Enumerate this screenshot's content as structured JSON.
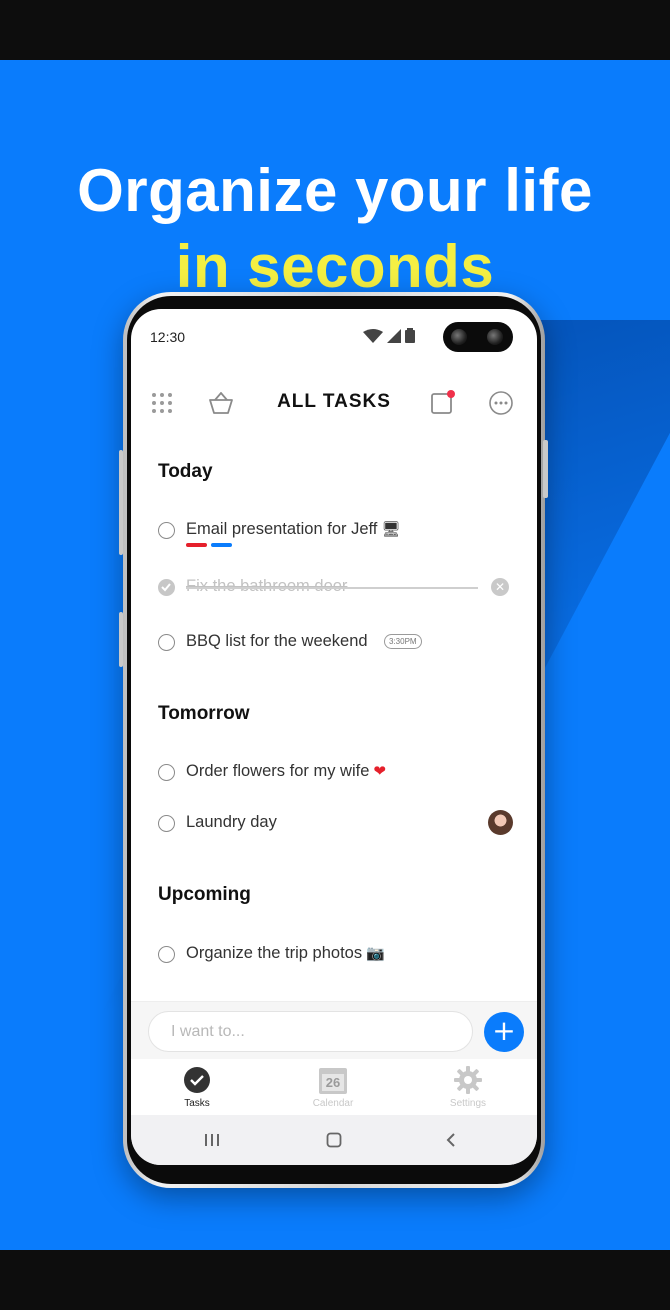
{
  "headline": {
    "line1": "Organize your life",
    "line2": "in seconds"
  },
  "status_bar": {
    "time": "12:30"
  },
  "header": {
    "title": "ALL TASKS"
  },
  "sections": [
    {
      "title": "Today",
      "tasks": [
        {
          "text": "Email presentation for Jeff",
          "emoji": "🖥",
          "done": false,
          "tags": [
            "#e5202b",
            "#0a7cfc"
          ]
        },
        {
          "text": "Fix the bathroom door",
          "done": true
        },
        {
          "text": "BBQ list for the weekend",
          "time": "3:30PM",
          "done": false
        }
      ]
    },
    {
      "title": "Tomorrow",
      "tasks": [
        {
          "text": "Order flowers for my wife",
          "emoji": "❤",
          "done": false
        },
        {
          "text": "Laundry day",
          "has_avatar": true,
          "done": false
        }
      ]
    },
    {
      "title": "Upcoming",
      "tasks": [
        {
          "text": "Organize the trip photos",
          "emoji": "📷",
          "done": false
        }
      ]
    }
  ],
  "input": {
    "placeholder": "I want to..."
  },
  "tabs": [
    {
      "label": "Tasks",
      "icon": "check-circle-icon",
      "active": true
    },
    {
      "label": "Calendar",
      "icon": "calendar-icon",
      "day": "26",
      "active": false
    },
    {
      "label": "Settings",
      "icon": "gear-icon",
      "active": false
    }
  ],
  "colors": {
    "background": "#0a7cfc",
    "accent_yellow": "#f4ef43",
    "notification_dot": "#f0304a"
  }
}
